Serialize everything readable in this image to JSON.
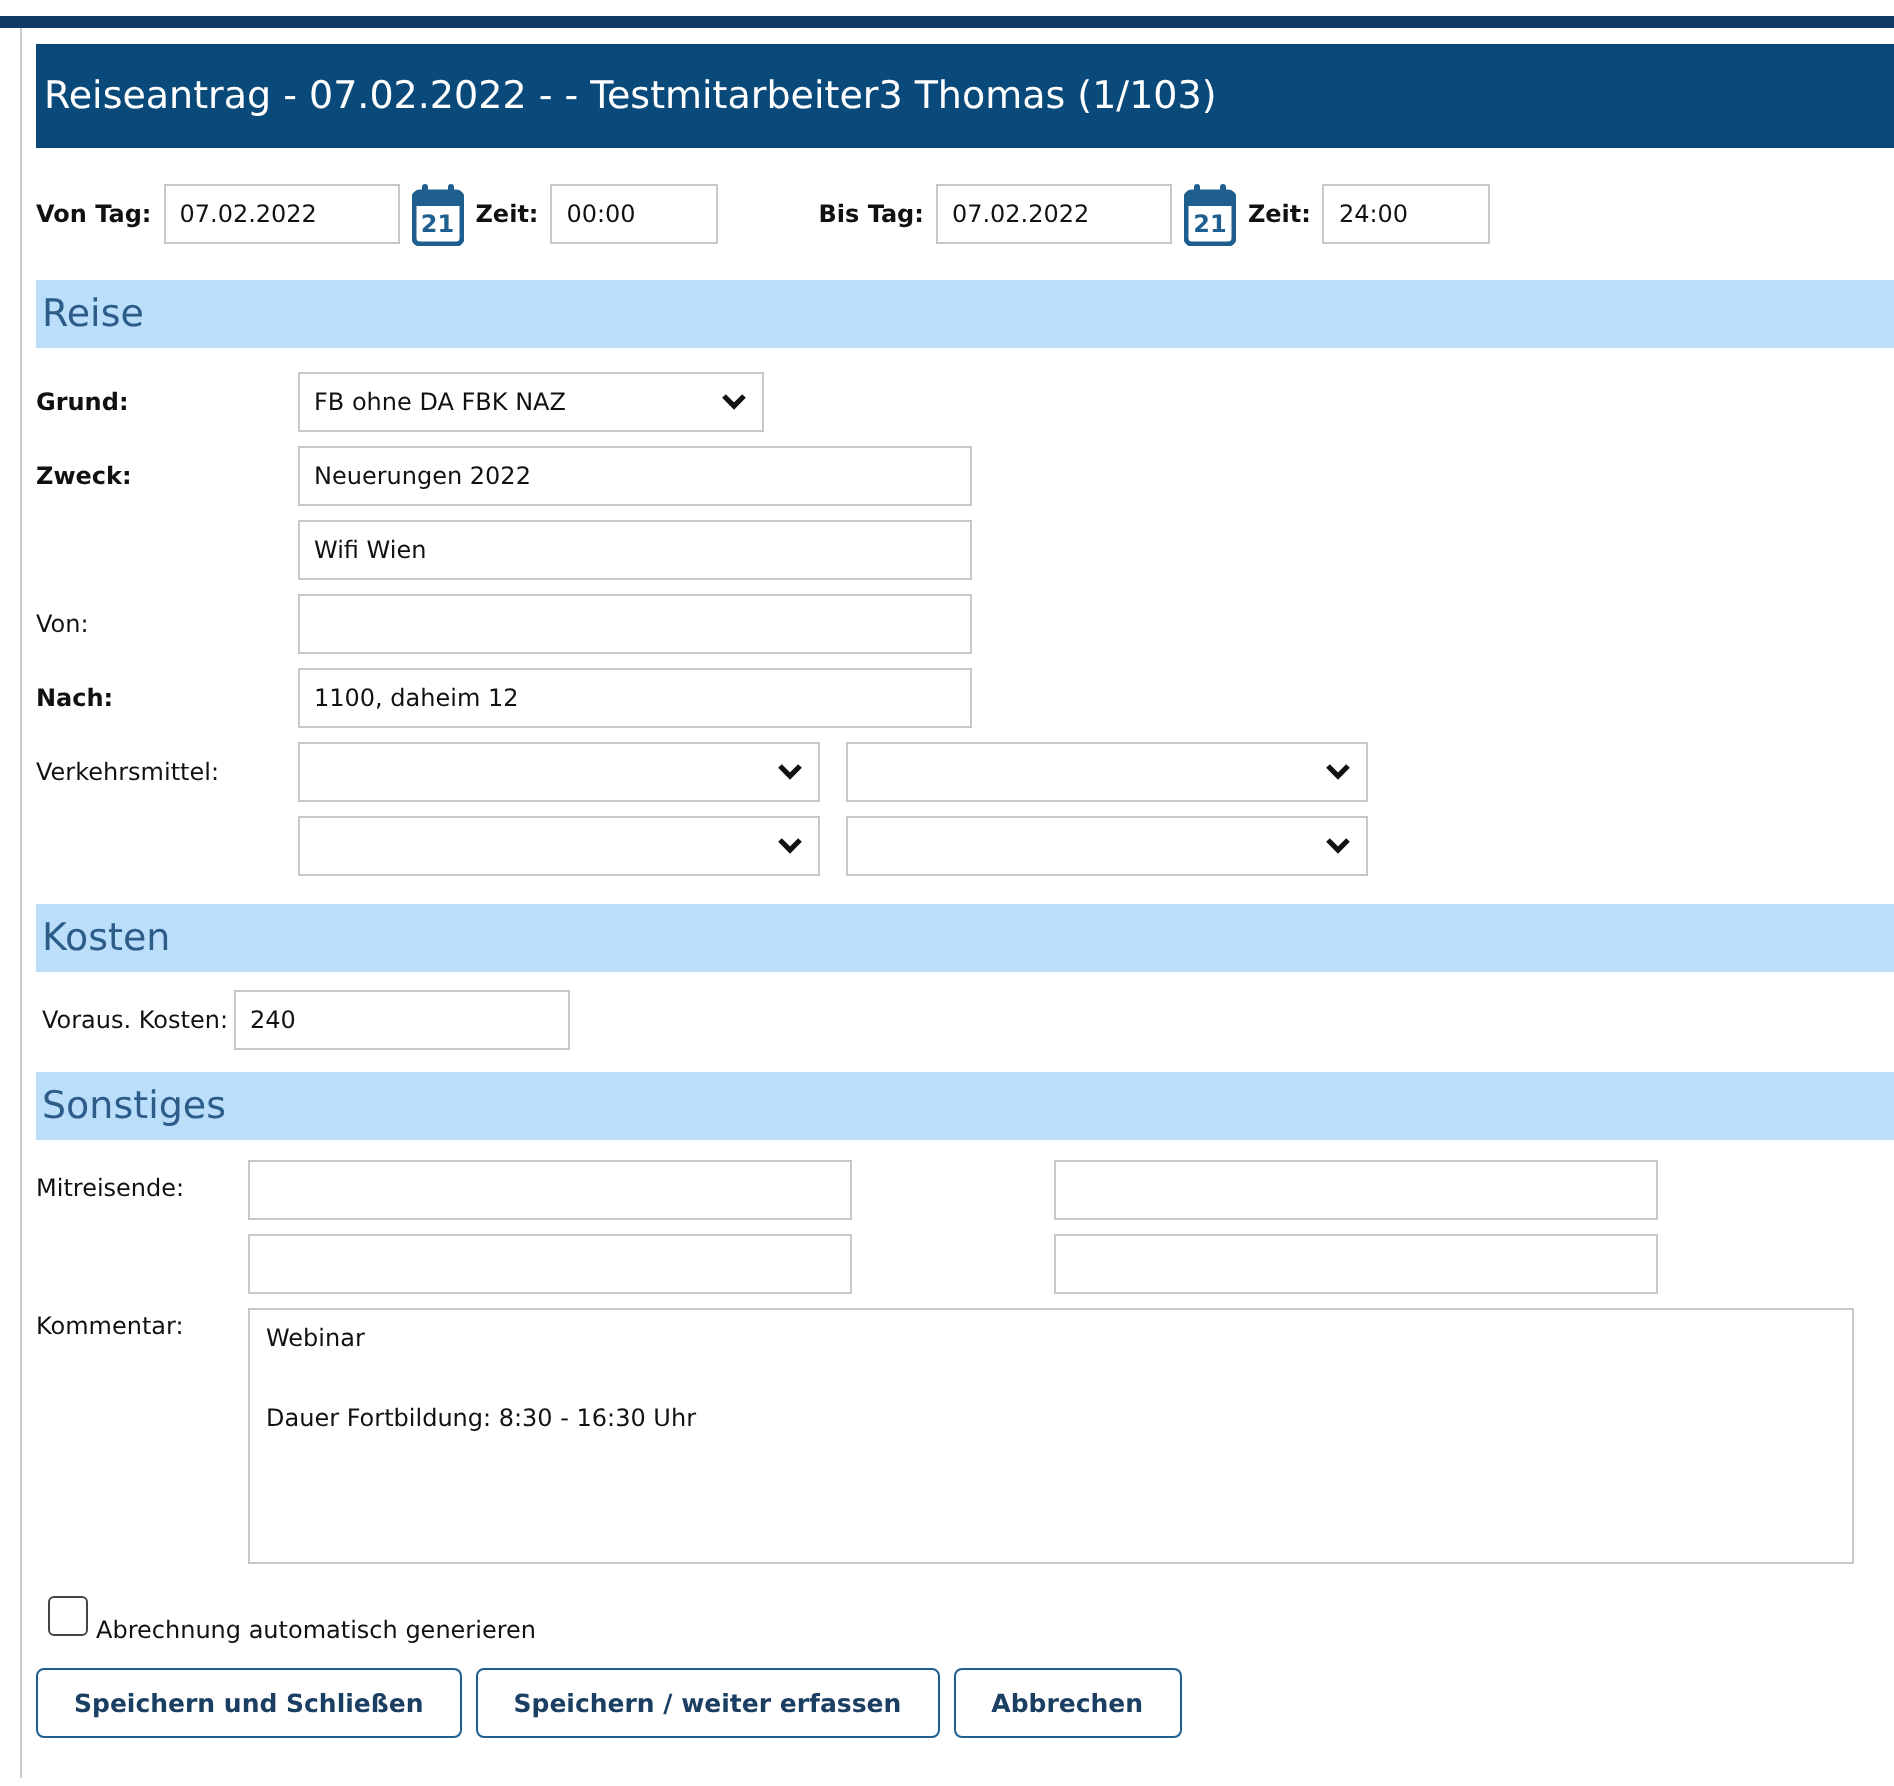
{
  "title": "Reiseantrag - 07.02.2022 - - Testmitarbeiter3 Thomas (1/103)",
  "date_range": [
    {
      "label": "Von Tag:",
      "date": "07.02.2022",
      "calendar_day": "21",
      "time_label": "Zeit:",
      "time": "00:00"
    },
    {
      "label": "Bis Tag:",
      "date": "07.02.2022",
      "calendar_day": "21",
      "time_label": "Zeit:",
      "time": "24:00"
    }
  ],
  "reise": {
    "heading": "Reise",
    "rows": [
      {
        "kind": "select",
        "label": "Grund:",
        "required": true,
        "value": "FB ohne DA FBK NAZ"
      },
      {
        "kind": "text",
        "label": "Zweck:",
        "required": true,
        "value": "Neuerungen 2022"
      },
      {
        "kind": "text",
        "value": "Wifi Wien"
      },
      {
        "kind": "text",
        "label": "Von:",
        "required": false
      },
      {
        "kind": "text",
        "label": "Nach:",
        "required": true,
        "value": "1100, daheim 12"
      },
      {
        "kind": "select_pair",
        "label": "Verkehrsmittel:",
        "required": false
      },
      {
        "kind": "select_pair"
      }
    ]
  },
  "kosten": {
    "heading": "Kosten",
    "label": "Voraus. Kosten:",
    "value": "240"
  },
  "sonstiges": {
    "heading": "Sonstiges",
    "companions_label": "Mitreisende:",
    "comment_label": "Kommentar:",
    "comment": "Webinar\n\nDauer Fortbildung: 8:30 - 16:30 Uhr"
  },
  "auto_settlement": {
    "label": "Abrechnung automatisch generieren",
    "checked": false
  },
  "buttons": [
    "Speichern und Schließen",
    "Speichern / weiter erfassen",
    "Abbrechen"
  ]
}
